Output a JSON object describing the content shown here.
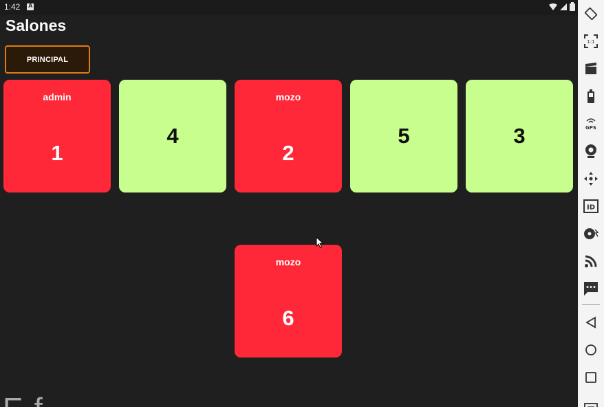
{
  "statusbar": {
    "time": "1:42"
  },
  "header": {
    "title": "Salones"
  },
  "tabs": [
    {
      "label": "PRINCIPAL",
      "active": true
    }
  ],
  "tables": [
    {
      "number": "1",
      "user": "admin",
      "status": "busy"
    },
    {
      "number": "4",
      "user": "",
      "status": "free"
    },
    {
      "number": "2",
      "user": "mozo",
      "status": "busy"
    },
    {
      "number": "5",
      "user": "",
      "status": "free"
    },
    {
      "number": "3",
      "user": "",
      "status": "free"
    },
    {
      "number": "6",
      "user": "mozo",
      "status": "busy"
    }
  ],
  "bottom_text": "E   f",
  "emulator_toolbar": {
    "items": [
      "rotate-icon",
      "one-to-one-icon",
      "screen-record-icon",
      "battery-icon",
      "gps-icon",
      "camera-icon",
      "dpad-icon",
      "id-icon",
      "fingerprint-icon",
      "broadcast-icon",
      "sms-icon",
      "back-icon",
      "home-icon",
      "recents-icon",
      "menu-icon"
    ],
    "gps_label": "GPS",
    "id_label": "ID",
    "ratio_label": "1:1"
  },
  "colors": {
    "busy": "#ff2838",
    "free": "#c7fe8d",
    "accent": "#e07b16",
    "background": "#1f1f1f"
  }
}
